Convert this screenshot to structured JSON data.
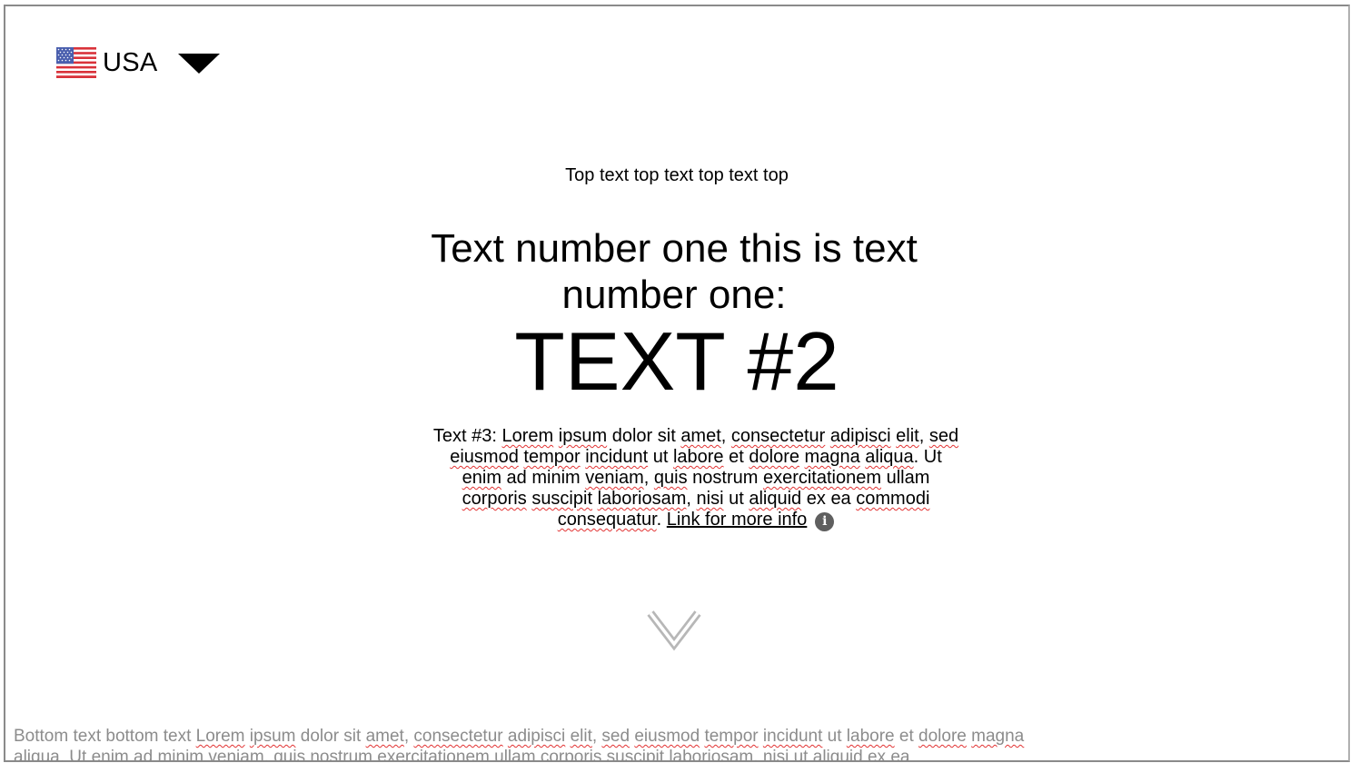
{
  "country_selector": {
    "label": "USA",
    "flag_icon": "us-flag-icon",
    "dropdown_icon": "caret-down-icon"
  },
  "hero": {
    "top_text": "Top text top text top text top",
    "headline": "Text number one this is text number one:",
    "big_text": "TEXT #2",
    "description_prefix": "Text #3:",
    "description_body": "Lorem ipsum dolor sit amet, consectetur adipisci elit, sed eiusmod tempor incidunt ut labore et dolore magna aliqua. Ut enim ad minim veniam, quis nostrum exercitationem ullam corporis suscipit laboriosam, nisi ut aliquid ex ea commodi consequatur.",
    "link_label": "Link for more info",
    "info_icon": "info-icon",
    "info_icon_glyph": "i"
  },
  "scroll_down_icon": "chevron-down-icon",
  "bottom_text": {
    "prefix": "Bottom text bottom text",
    "body": "Lorem ipsum dolor sit amet, consectetur adipisci elit, sed eiusmod tempor incidunt ut labore et dolore magna aliqua. Ut enim ad minim veniam, quis nostrum exercitationem ullam corporis suscipit laboriosam, nisi ut aliquid ex ea"
  },
  "colors": {
    "spellcheck_underline": "#e23333",
    "info_icon_bg": "#5f5f5f",
    "bottom_text": "#8c8c8c"
  }
}
